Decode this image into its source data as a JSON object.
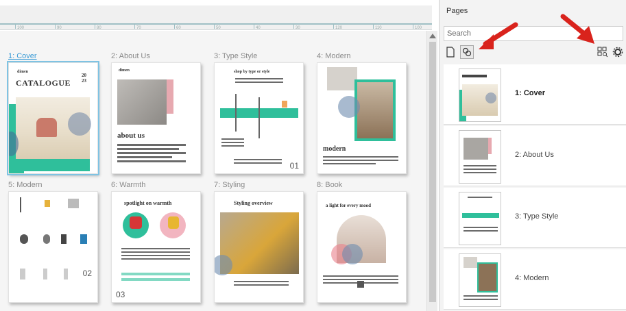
{
  "canvas": {
    "ruler_numbers": [
      "100",
      "90",
      "80",
      "70",
      "60",
      "50",
      "40",
      "30",
      "120",
      "110",
      "100",
      "90"
    ],
    "pages": [
      {
        "label": "1: Cover",
        "active": true,
        "cover_title": "CATALOGUE",
        "cover_brand": "dimen",
        "cover_year": "2023"
      },
      {
        "label": "2: About Us",
        "heading": "about us",
        "brand": "dimen"
      },
      {
        "label": "3: Type Style",
        "heading": "shop by type or style",
        "number": "01"
      },
      {
        "label": "4: Modern",
        "heading": "modern"
      },
      {
        "label": "5: Modern",
        "number": "02"
      },
      {
        "label": "6: Warmth",
        "heading": "spotlight on warmth",
        "number": "03"
      },
      {
        "label": "7: Styling",
        "heading": "Styling overview"
      },
      {
        "label": "8: Book",
        "heading": "a light for every mood"
      }
    ]
  },
  "panel": {
    "title": "Pages",
    "search_placeholder": "Search",
    "toolbar": {
      "new_page_icon": "page-icon",
      "duplicate_icon": "duplicate-pages-icon",
      "grid_view_icon": "grid-view-icon",
      "settings_icon": "gear-icon"
    },
    "rows": [
      {
        "label": "1: Cover",
        "active": true
      },
      {
        "label": "2: About Us",
        "active": false
      },
      {
        "label": "3: Type Style",
        "active": false
      },
      {
        "label": "4: Modern",
        "active": false
      }
    ]
  },
  "colors": {
    "accent_teal": "#2fbf9b",
    "selection_blue": "#3a9bd6",
    "annotation_red": "#d9231c"
  }
}
